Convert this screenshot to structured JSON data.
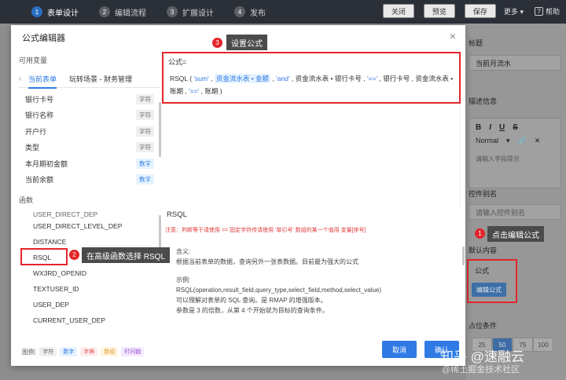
{
  "topbar": {
    "steps": [
      {
        "num": "1",
        "label": "表单设计"
      },
      {
        "num": "2",
        "label": "编辑流程"
      },
      {
        "num": "3",
        "label": "扩展设计"
      },
      {
        "num": "4",
        "label": "发布"
      }
    ],
    "close_label": "关闭",
    "preview_label": "预览",
    "save_label": "保存",
    "more_label": "更多",
    "help_label": "帮助"
  },
  "right_panel": {
    "title_label": "标题",
    "title_value": "当前月流水",
    "desc_label": "描述信息",
    "toolbar": [
      "B",
      "I",
      "U",
      "S"
    ],
    "normal_label": "Normal",
    "desc_placeholder": "请输入字段提示",
    "alias_label": "控件别名",
    "alias_placeholder": "请输入控件别名",
    "default_label": "默认内容",
    "formula_label": "公式",
    "edit_formula_label": "编辑公式",
    "width_label": "占位条件",
    "width_options": [
      "25",
      "50",
      "75",
      "100"
    ]
  },
  "modal": {
    "title": "公式编辑器",
    "vars_label": "可用变量",
    "tabs": [
      "当前表单",
      "玩转场景 - 财务管理"
    ],
    "variables": [
      {
        "name": "银行卡号",
        "type": "字符"
      },
      {
        "name": "银行名称",
        "type": "字符"
      },
      {
        "name": "开户行",
        "type": "字符"
      },
      {
        "name": "类型",
        "type": "字符"
      },
      {
        "name": "本月期初金额",
        "type": "数字"
      },
      {
        "name": "当前余额",
        "type": "数字"
      }
    ],
    "funcs_label": "函数",
    "functions": [
      "USER_DIRECT_DEP",
      "USER_DIRECT_LEVEL_DEP",
      "DISTANCE",
      "RSQL",
      "WX3RD_OPENID",
      "TEXTUSER_ID",
      "USER_DEP",
      "CURRENT_USER_DEP"
    ],
    "formula_label": "公式=",
    "formula": {
      "fn": "RSQL",
      "open": " ( ",
      "p1": "'sum'",
      "sep": " , ",
      "p2": "资金流水表 • 金额",
      "p3": "'and'",
      "p4": "资金流水表 • 银行卡号",
      "p5": "'=='",
      "p6": "银行卡号",
      "p7": "资金流水表 • 账期",
      "p8": "'=='",
      "p9": "账期",
      "close": " )"
    },
    "fn_name": "RSQL",
    "fn_note": "注意：判断等于请使用 == 固定字符传请使用 '单引号' 数组的某一个值用 变量[序号]",
    "help": {
      "desc_title": "含义:",
      "desc": "根据当前表单的数据，查询另外一张表数据。目前最为强大的公式",
      "example_title": "示例:",
      "example": "RSQL(operation,result_field,query_type,select_field,method,select_value)",
      "line1": "可以理解对表单的 SQL 查询。是 RMAP 的增强版本。",
      "line2": "参数是 3 的倍数，从第 4 个开始就为目标的查询条件。"
    },
    "legend_label": "图例:",
    "legend": [
      "字符",
      "数字",
      "字典",
      "数组",
      "时间戳"
    ],
    "cancel_label": "取消",
    "ok_label": "确认"
  },
  "annotations": {
    "c1_num": "1",
    "c1_text": "点击编辑公式",
    "c2_num": "2",
    "c2_text": "在高级函数选择 RSQL",
    "c3_num": "3",
    "c3_text": "设置公式"
  },
  "watermark": {
    "main": "知乎 @速融云",
    "sub": "@稀土掘金技术社区"
  },
  "colors": {
    "accent": "#2f7ae5",
    "highlight": "#e3262b"
  }
}
